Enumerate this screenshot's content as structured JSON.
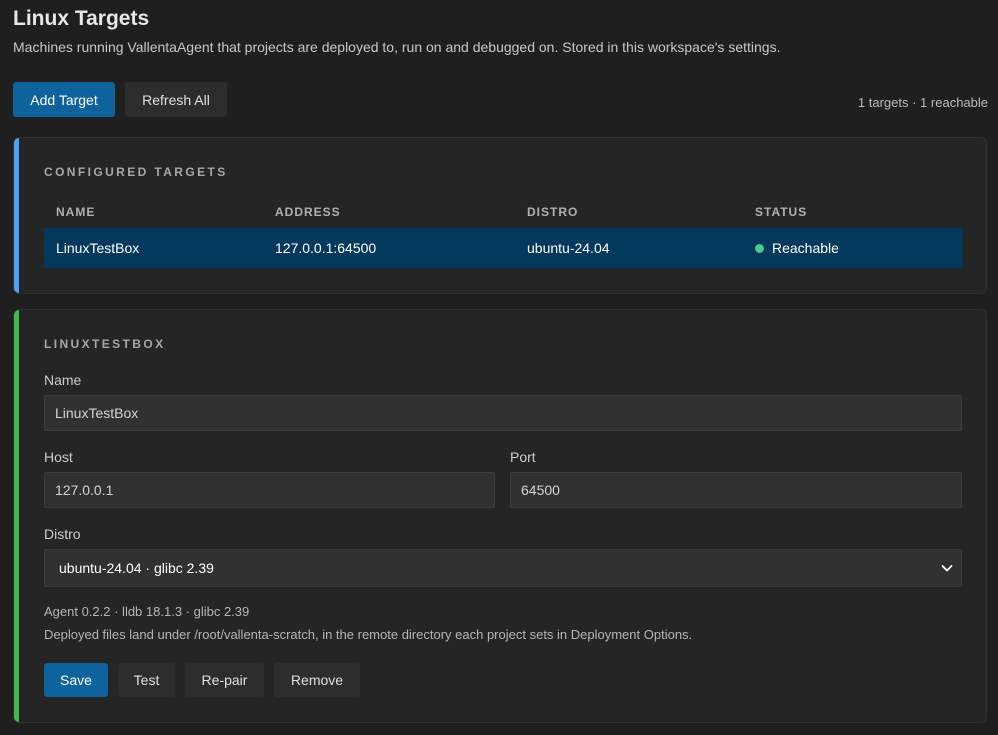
{
  "page": {
    "title": "Linux Targets",
    "description": "Machines running VallentaAgent that projects are deployed to, run on and debugged on. Stored in this workspace's settings."
  },
  "toolbar": {
    "add_label": "Add Target",
    "refresh_label": "Refresh All",
    "summary": "1 targets · 1 reachable"
  },
  "targets": {
    "section_title": "CONFIGURED TARGETS",
    "columns": [
      "NAME",
      "ADDRESS",
      "DISTRO",
      "STATUS"
    ],
    "rows": [
      {
        "name": "LinuxTestBox",
        "address": "127.0.0.1:64500",
        "distro": "ubuntu-24.04",
        "status": "Reachable",
        "status_color": "#4ec98a"
      }
    ]
  },
  "detail": {
    "section_title": "LINUXTESTBOX",
    "name_label": "Name",
    "name_value": "LinuxTestBox",
    "host_label": "Host",
    "host_value": "127.0.0.1",
    "port_label": "Port",
    "port_value": "64500",
    "distro_label": "Distro",
    "distro_selected": "ubuntu-24.04 · glibc 2.39",
    "agent_info": "Agent 0.2.2 · lldb 18.1.3 · glibc 2.39",
    "deploy_note": "Deployed files land under /root/vallenta-scratch, in the remote directory each project sets in Deployment Options.",
    "actions": {
      "save": "Save",
      "test": "Test",
      "repair": "Re-pair",
      "remove": "Remove"
    }
  },
  "colors": {
    "primary_button": "#0e639c",
    "targets_accent": "#4fa3f7",
    "detail_accent": "#3fb950",
    "selected_row": "#04395e"
  },
  "icons": {
    "select_chevron": "chevron-down-icon",
    "status": "status-dot-icon"
  }
}
